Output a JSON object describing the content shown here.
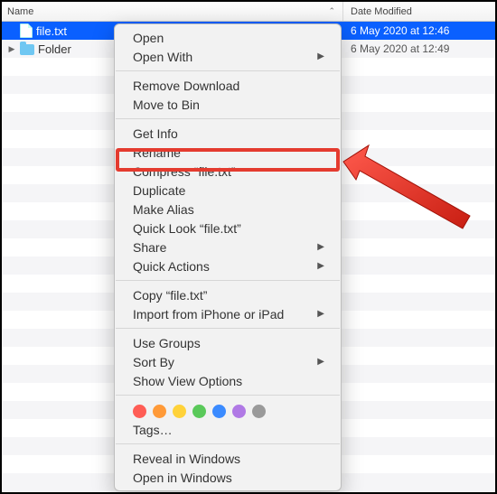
{
  "header": {
    "name_col": "Name",
    "date_col": "Date Modified"
  },
  "rows": [
    {
      "name": "file.txt",
      "date": "6 May 2020 at 12:46",
      "type": "file",
      "selected": true
    },
    {
      "name": "Folder",
      "date": "6 May 2020 at 12:49",
      "type": "folder",
      "selected": false
    }
  ],
  "menu": {
    "open": "Open",
    "open_with": "Open With",
    "remove_download": "Remove Download",
    "move_to_bin": "Move to Bin",
    "get_info": "Get Info",
    "rename": "Rename",
    "compress": "Compress “file.txt”",
    "duplicate": "Duplicate",
    "make_alias": "Make Alias",
    "quick_look": "Quick Look “file.txt”",
    "share": "Share",
    "quick_actions": "Quick Actions",
    "copy": "Copy “file.txt”",
    "import": "Import from iPhone or iPad",
    "use_groups": "Use Groups",
    "sort_by": "Sort By",
    "show_view_options": "Show View Options",
    "tags": "Tags…",
    "reveal_in_windows": "Reveal in Windows",
    "open_in_windows": "Open in Windows"
  },
  "tag_colors": [
    "#ff5d55",
    "#ff9a38",
    "#ffd23a",
    "#5ac95a",
    "#3b8bff",
    "#b079e5",
    "#9a9a9a"
  ]
}
